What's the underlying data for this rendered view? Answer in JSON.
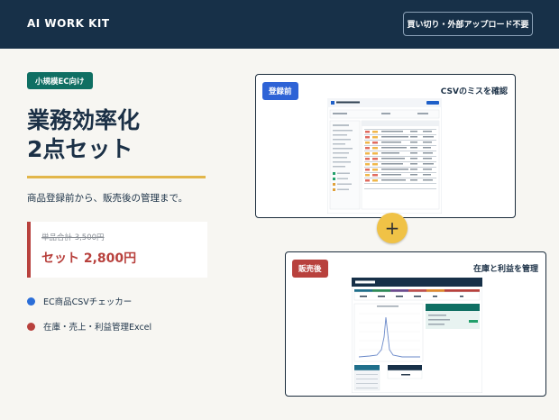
{
  "header": {
    "brand": "AI WORK KIT",
    "cta_label": "買い切り・外部アップロード不要"
  },
  "hero": {
    "badge": "小規模EC向け",
    "title_line1": "業務効率化",
    "title_line2": "2点セット",
    "subtitle": "商品登録前から、販売後の管理まで。"
  },
  "pricing": {
    "original": "単品合計 3,500円",
    "set_price": "セット 2,800円"
  },
  "features": [
    {
      "label": "EC商品CSVチェッカー"
    },
    {
      "label": "在庫・売上・利益管理Excel"
    }
  ],
  "colors": {
    "header_bg": "#173048",
    "badge_bg": "#0f6f63",
    "accent_gold": "#e2b64a",
    "accent_red": "#b8413d",
    "accent_blue": "#2e63d6"
  },
  "cards": {
    "before": {
      "tag": "登録前",
      "caption": "CSVのミスを確認"
    },
    "after": {
      "tag": "販売後",
      "caption": "在庫と利益を管理"
    }
  },
  "icons": {
    "plus": "+"
  }
}
